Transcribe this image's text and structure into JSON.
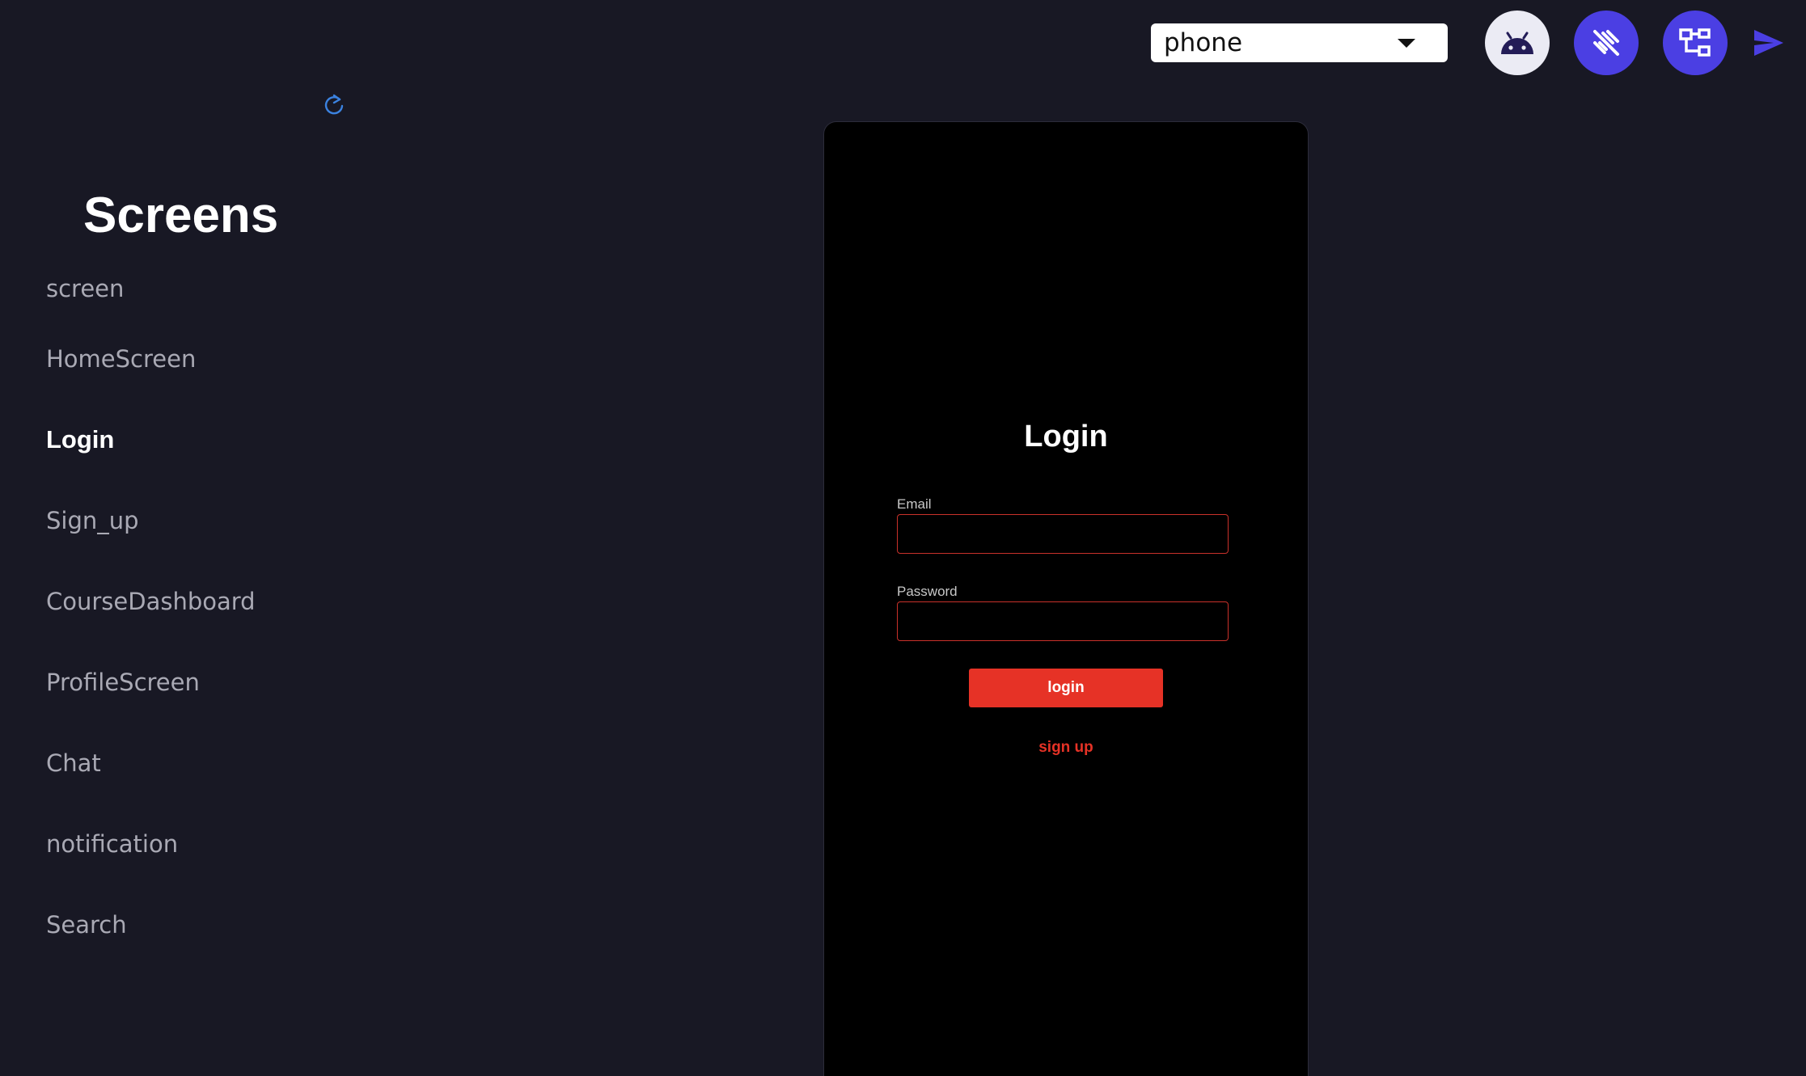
{
  "toolbar": {
    "device_select": {
      "value": "phone"
    },
    "icons": {
      "android": "android-icon",
      "unlink": "link-off-icon",
      "tree": "component-tree-icon",
      "send": "send-icon",
      "refresh": "refresh-icon"
    },
    "colors": {
      "accent": "#4b3fe3",
      "android_bg": "#ebebf4"
    }
  },
  "sidebar": {
    "title": "Screens",
    "items": [
      {
        "label": "screen",
        "active": false
      },
      {
        "label": "HomeScreen",
        "active": false
      },
      {
        "label": "Login",
        "active": true
      },
      {
        "label": "Sign_up",
        "active": false
      },
      {
        "label": "CourseDashboard",
        "active": false
      },
      {
        "label": "ProfileScreen",
        "active": false
      },
      {
        "label": "Chat",
        "active": false
      },
      {
        "label": "notification",
        "active": false
      },
      {
        "label": "Search",
        "active": false
      }
    ]
  },
  "preview": {
    "title": "Login",
    "email": {
      "label": "Email",
      "value": ""
    },
    "password": {
      "label": "Password",
      "value": ""
    },
    "login_button": "login",
    "signup_link": "sign up",
    "colors": {
      "primary": "#e63226",
      "background": "#000000"
    }
  }
}
